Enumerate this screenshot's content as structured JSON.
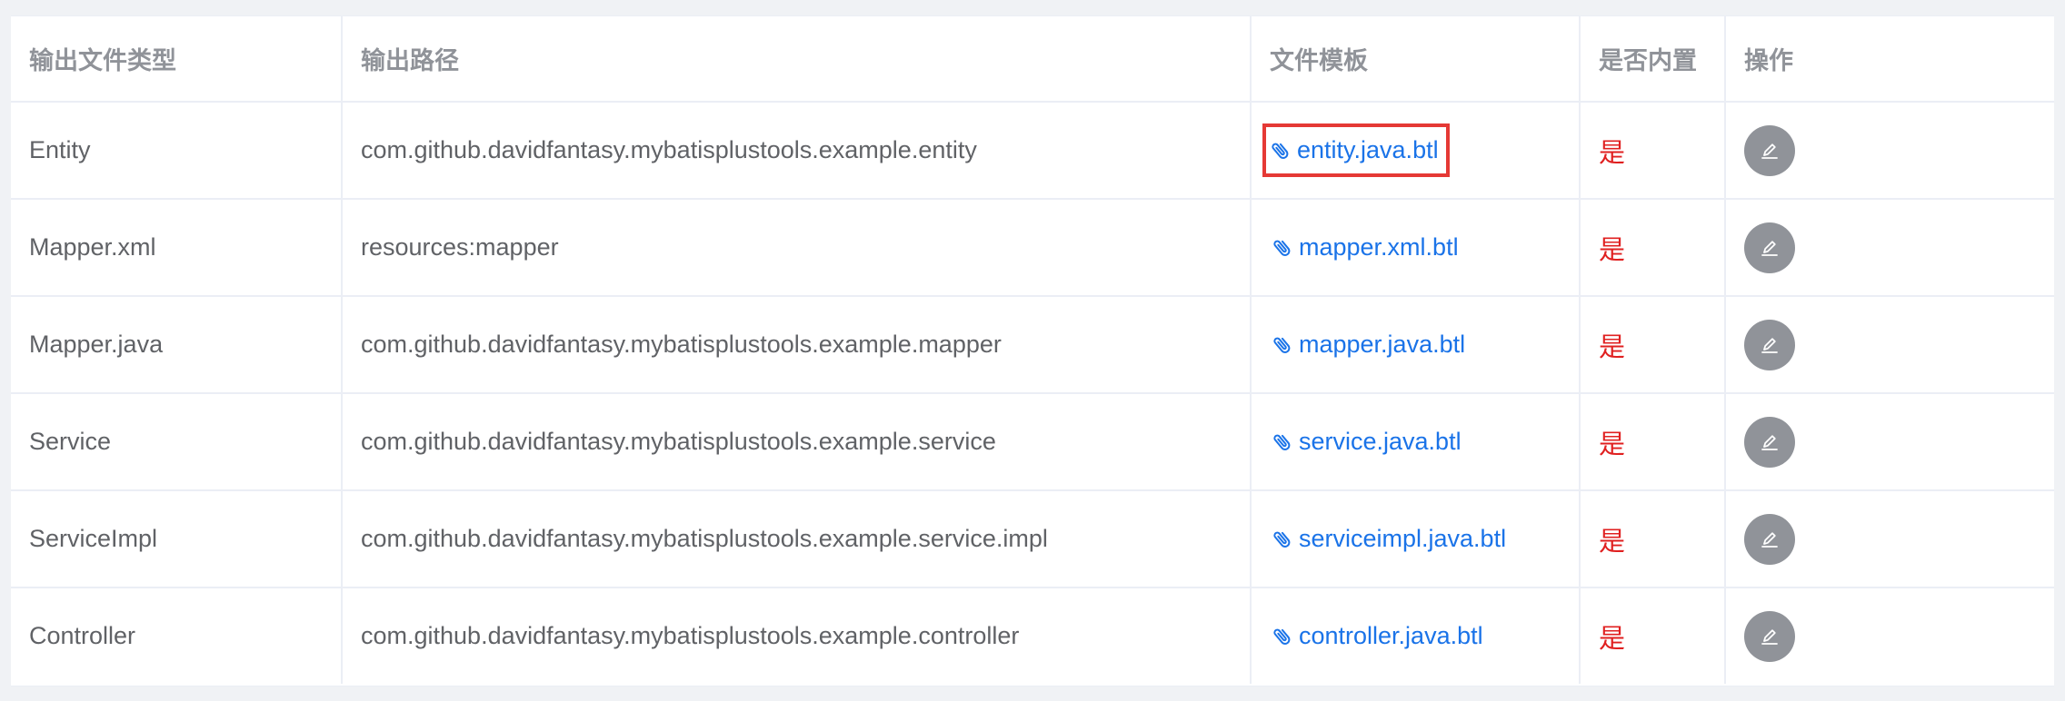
{
  "table": {
    "headers": {
      "type": "输出文件类型",
      "path": "输出路径",
      "template": "文件模板",
      "builtin": "是否内置",
      "action": "操作"
    },
    "rows": [
      {
        "type": "Entity",
        "path": "com.github.davidfantasy.mybatisplustools.example.entity",
        "template": "entity.java.btl",
        "builtin": "是"
      },
      {
        "type": "Mapper.xml",
        "path": "resources:mapper",
        "template": "mapper.xml.btl",
        "builtin": "是"
      },
      {
        "type": "Mapper.java",
        "path": "com.github.davidfantasy.mybatisplustools.example.mapper",
        "template": "mapper.java.btl",
        "builtin": "是"
      },
      {
        "type": "Service",
        "path": "com.github.davidfantasy.mybatisplustools.example.service",
        "template": "service.java.btl",
        "builtin": "是"
      },
      {
        "type": "ServiceImpl",
        "path": "com.github.davidfantasy.mybatisplustools.example.service.impl",
        "template": "serviceimpl.java.btl",
        "builtin": "是"
      },
      {
        "type": "Controller",
        "path": "com.github.davidfantasy.mybatisplustools.example.controller",
        "template": "controller.java.btl",
        "builtin": "是"
      }
    ]
  },
  "icons": {
    "template_link": "paperclip-icon",
    "edit": "edit-icon"
  },
  "colors": {
    "link": "#1a73e8",
    "builtin": "#e02020",
    "highlight_box": "#e53935",
    "edit_button": "#909399",
    "header_text": "#909399",
    "body_text": "#606266"
  }
}
